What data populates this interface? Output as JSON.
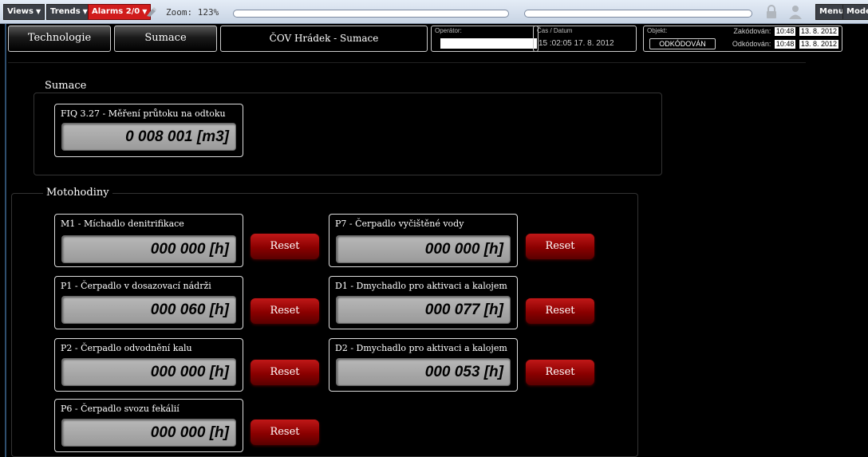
{
  "toolbar": {
    "views_label": "Views",
    "trends_label": "Trends",
    "alarms_label": "Alarms 2/0",
    "zoom_text": "Zoom: 123%",
    "menu_label": "Menu",
    "mode_label": "Mode"
  },
  "header": {
    "tab_technologie": "Technologie",
    "tab_sumace": "Sumace",
    "title": "ČOV Hrádek - Sumace",
    "operator_label": "Operátor:",
    "datetime_label": "Čas / Datum",
    "datetime_value": "15 :02:05   17. 8. 2012",
    "object_label": "Objekt:",
    "object_status": "ODKÓDOVÁN",
    "encoded_label": "Zakódován:",
    "encoded_time": "10:48",
    "encoded_date": "13. 8. 2012",
    "decoded_label": "Odkódován:",
    "decoded_time": "10:48",
    "decoded_date": "13. 8. 2012"
  },
  "sumace": {
    "section_title": "Sumace",
    "meter": {
      "label": "FIQ 3.27 - Měření průtoku na odtoku",
      "value": "0 008 001 [m3]"
    }
  },
  "motohodiny": {
    "section_title": "Motohodiny",
    "reset_label": "Reset",
    "left": [
      {
        "label": "M1 - Míchadlo denitrifikace",
        "value": "000 000 [h]"
      },
      {
        "label": "P1 - Čerpadlo v dosazovací nádrži",
        "value": "000 060 [h]"
      },
      {
        "label": "P2 - Čerpadlo odvodnění kalu",
        "value": "000 000 [h]"
      },
      {
        "label": "P6 - Čerpadlo svozu fekálií",
        "value": "000 000 [h]"
      }
    ],
    "right": [
      {
        "label": "P7 - Čerpadlo vyčištěné vody",
        "value": "000 000 [h]"
      },
      {
        "label": "D1 - Dmychadlo pro aktivaci a kalojem",
        "value": "000 077 [h]"
      },
      {
        "label": "D2 - Dmychadlo pro aktivaci a kalojem",
        "value": "000 053 [h]"
      }
    ]
  }
}
